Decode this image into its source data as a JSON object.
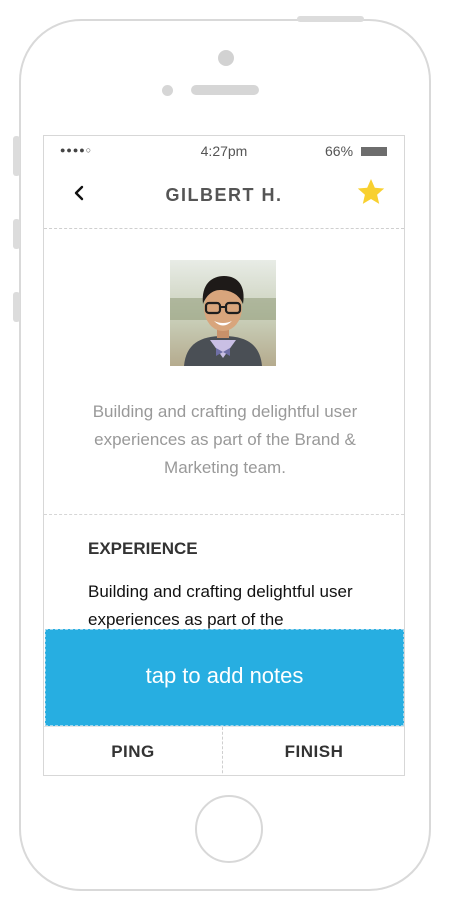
{
  "status_bar": {
    "signal": "●●●●○",
    "time": "4:27pm",
    "battery": "66%"
  },
  "nav": {
    "title": "GILBERT H.",
    "back_icon": "chevron-left-icon",
    "favorite_icon": "star-icon"
  },
  "profile": {
    "bio": "Building and crafting delightful user experiences as part of the Brand & Marketing team."
  },
  "experience": {
    "heading": "EXPERIENCE",
    "text": "Building and crafting delightful user experiences as part of the"
  },
  "notes_button": {
    "label": "tap to add notes"
  },
  "actions": {
    "ping": "PING",
    "finish": "FINISH"
  },
  "colors": {
    "accent": "#27aee1",
    "star": "#f8d030"
  }
}
